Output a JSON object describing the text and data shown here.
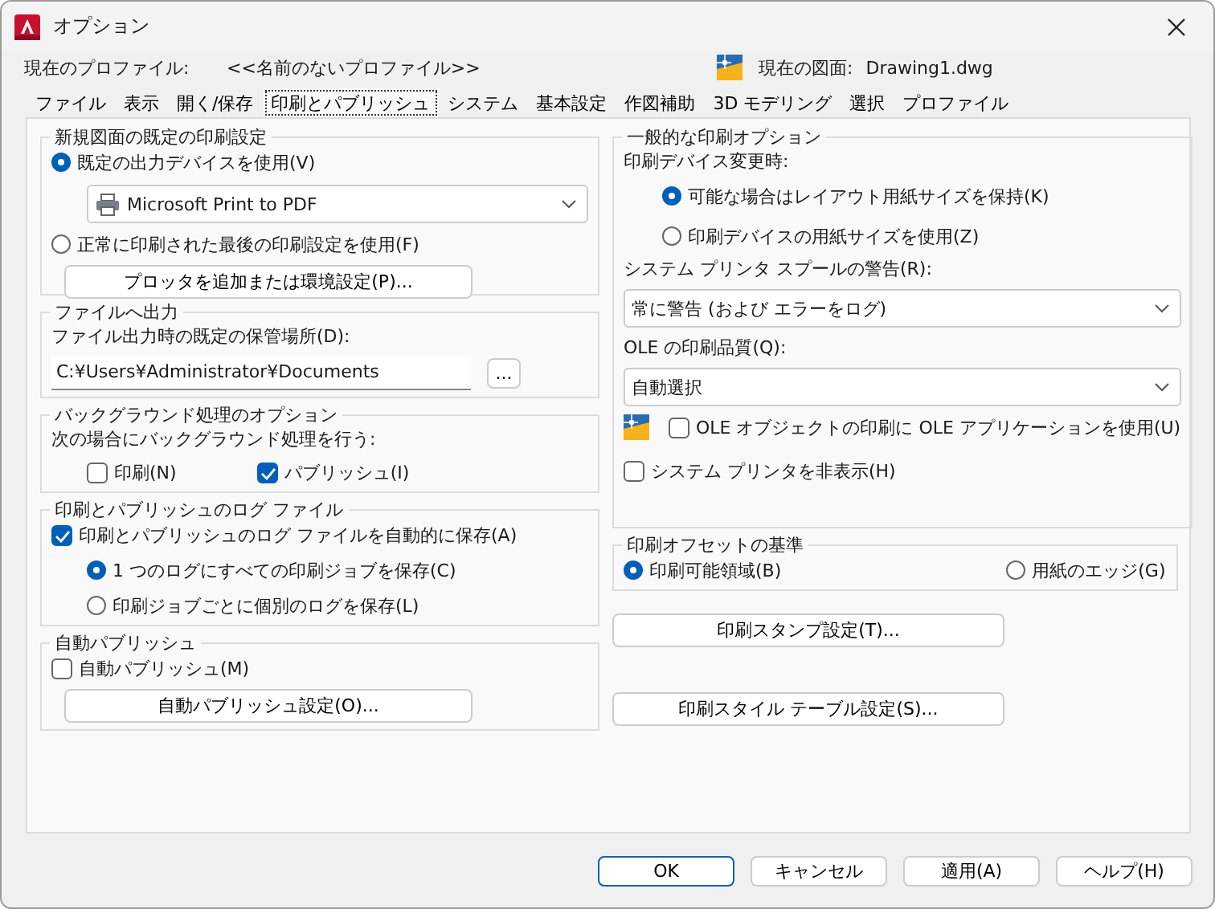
{
  "window": {
    "title": "オプション"
  },
  "profile": {
    "label": "現在のプロファイル:",
    "value": "<<名前のないプロファイル>>"
  },
  "drawing": {
    "label": "現在の図面:",
    "value": "Drawing1.dwg"
  },
  "tabs": [
    {
      "label": "ファイル",
      "selected": false
    },
    {
      "label": "表示",
      "selected": false
    },
    {
      "label": "開く/保存",
      "selected": false
    },
    {
      "label": "印刷とパブリッシュ",
      "selected": true
    },
    {
      "label": "システム",
      "selected": false
    },
    {
      "label": "基本設定",
      "selected": false
    },
    {
      "label": "作図補助",
      "selected": false
    },
    {
      "label": "3D モデリング",
      "selected": false
    },
    {
      "label": "選択",
      "selected": false
    },
    {
      "label": "プロファイル",
      "selected": false
    }
  ],
  "left_groups": [
    {
      "title": "新規図面の既定の印刷設定",
      "items": [
        {
          "kind": "radio",
          "label": "既定の出力デバイスを使用(V)",
          "selected": true,
          "children": [
            {
              "kind": "device",
              "value": "Microsoft Print to PDF"
            }
          ]
        },
        {
          "kind": "radio",
          "label": "正常に印刷された最後の印刷設定を使用(F)",
          "selected": false
        },
        {
          "kind": "button",
          "label": "プロッタを追加または環境設定(P)..."
        }
      ]
    },
    {
      "title": "ファイルへ出力",
      "items": [
        {
          "kind": "label",
          "label": "ファイル出力時の既定の保管場所(D):"
        },
        {
          "kind": "path",
          "value": "C:¥Users¥Administrator¥Documents",
          "browse": "..."
        }
      ]
    },
    {
      "title": "バックグラウンド処理のオプション",
      "items": [
        {
          "kind": "label",
          "label": "次の場合にバックグラウンド処理を行う:"
        },
        {
          "kind": "options",
          "options": [
            {
              "kind": "checkbox",
              "label": "印刷(N)",
              "checked": false
            },
            {
              "kind": "checkbox",
              "label": "パブリッシュ(I)",
              "checked": true
            }
          ]
        }
      ]
    },
    {
      "title": "印刷とパブリッシュのログ ファイル",
      "items": [
        {
          "kind": "checkbox",
          "label": "印刷とパブリッシュのログ ファイルを自動的に保存(A)",
          "checked": true,
          "children": [
            {
              "kind": "radio",
              "label": "1 つのログにすべての印刷ジョブを保存(C)",
              "selected": true
            },
            {
              "kind": "radio",
              "label": "印刷ジョブごとに個別のログを保存(L)",
              "selected": false
            }
          ]
        }
      ]
    },
    {
      "title": "自動パブリッシュ",
      "items": [
        {
          "kind": "checkbox",
          "label": "自動パブリッシュ(M)",
          "checked": false
        },
        {
          "kind": "button",
          "label": "自動パブリッシュ設定(O)..."
        }
      ]
    }
  ],
  "right_groups": [
    {
      "title": "一般的な印刷オプション",
      "items": [
        {
          "kind": "label",
          "label": "印刷デバイス変更時:",
          "children": [
            {
              "kind": "radio",
              "label": "可能な場合はレイアウト用紙サイズを保持(K)",
              "selected": true
            },
            {
              "kind": "radio",
              "label": "印刷デバイスの用紙サイズを使用(Z)",
              "selected": false
            }
          ]
        },
        {
          "kind": "label",
          "label": "システム プリンタ スプールの警告(R):"
        },
        {
          "kind": "dropdown",
          "value": "常に警告 (および エラーをログ)"
        },
        {
          "kind": "label",
          "label": "OLE の印刷品質(Q):"
        },
        {
          "kind": "dropdown",
          "value": "自動選択"
        },
        {
          "kind": "olecheck",
          "label": "OLE オブジェクトの印刷に OLE アプリケーションを使用(U)",
          "checked": false
        },
        {
          "kind": "checkbox",
          "label": "システム プリンタを非表示(H)",
          "checked": false
        }
      ]
    },
    {
      "title": "印刷オフセットの基準",
      "items": [
        {
          "kind": "options",
          "options": [
            {
              "kind": "radio",
              "label": "印刷可能領域(B)",
              "selected": true
            },
            {
              "kind": "radio",
              "label": "用紙のエッジ(G)",
              "selected": false
            }
          ]
        }
      ]
    }
  ],
  "right_buttons": [
    "印刷スタンプ設定(T)...",
    "印刷スタイル テーブル設定(S)..."
  ],
  "footer_buttons": [
    {
      "label": "OK",
      "default": true
    },
    {
      "label": "キャンセル",
      "default": false
    },
    {
      "label": "適用(A)",
      "default": false
    },
    {
      "label": "ヘルプ(H)",
      "default": false
    }
  ]
}
